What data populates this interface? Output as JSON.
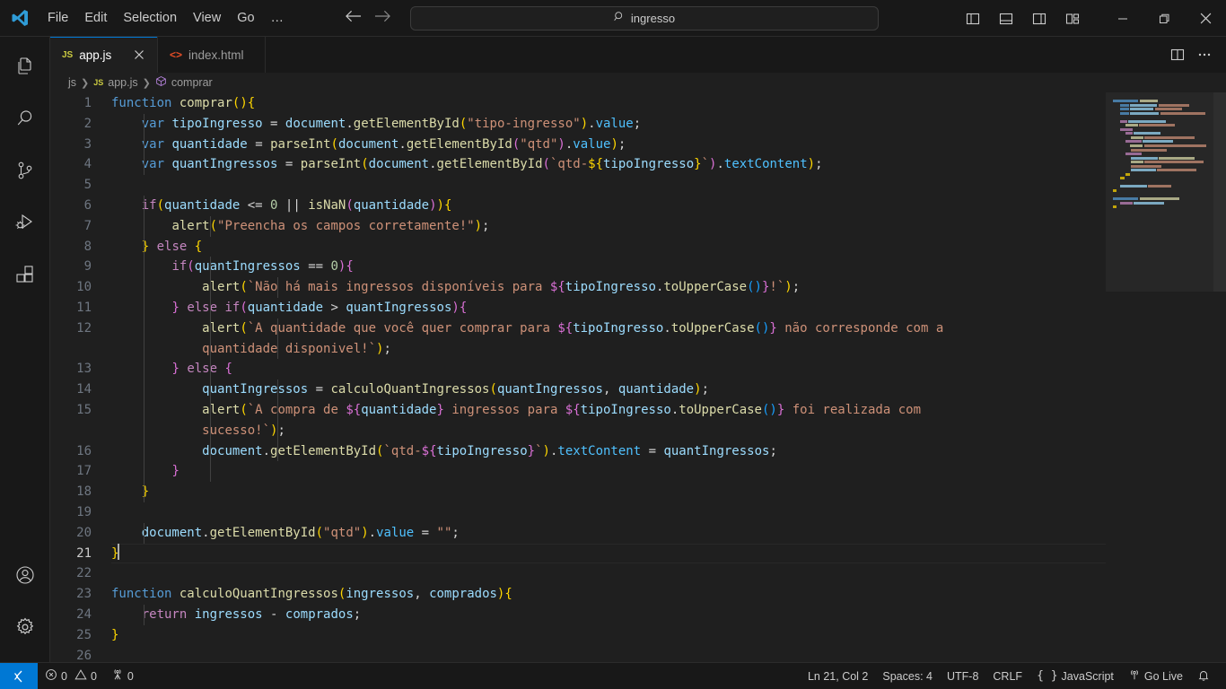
{
  "titlebar": {
    "logo_icon": "vscode-logo-icon",
    "menus": [
      "File",
      "Edit",
      "Selection",
      "View",
      "Go"
    ],
    "more_label": "…",
    "nav_back_icon": "arrow-left-icon",
    "nav_forward_icon": "arrow-right-icon",
    "command_center": {
      "search_icon": "search-icon",
      "value": "ingresso"
    },
    "layout_buttons": [
      {
        "name": "toggle-primary-sidebar-icon",
        "title": "Toggle Primary Side Bar"
      },
      {
        "name": "toggle-panel-icon",
        "title": "Toggle Panel"
      },
      {
        "name": "toggle-secondary-sidebar-icon",
        "title": "Toggle Secondary Side Bar"
      },
      {
        "name": "customize-layout-icon",
        "title": "Customize Layout"
      }
    ],
    "window_controls": [
      {
        "name": "minimize-button",
        "glyph": "—"
      },
      {
        "name": "maximize-button",
        "glyph": "❐"
      },
      {
        "name": "close-button",
        "glyph": "✕"
      }
    ]
  },
  "activitybar": {
    "top_items": [
      {
        "name": "sidebar-item-explorer",
        "label": "Explorer",
        "icon": "files-icon"
      },
      {
        "name": "sidebar-item-search",
        "label": "Search",
        "icon": "search-icon"
      },
      {
        "name": "sidebar-item-source-control",
        "label": "Source Control",
        "icon": "source-control-icon"
      },
      {
        "name": "sidebar-item-run-debug",
        "label": "Run and Debug",
        "icon": "run-debug-icon"
      },
      {
        "name": "sidebar-item-extensions",
        "label": "Extensions",
        "icon": "extensions-icon"
      }
    ],
    "bottom_items": [
      {
        "name": "accounts-button",
        "label": "Accounts",
        "icon": "account-icon"
      },
      {
        "name": "settings-button",
        "label": "Manage",
        "icon": "gear-icon"
      }
    ]
  },
  "tabs": [
    {
      "name": "tab-app-js",
      "label": "app.js",
      "icon": "js-file-icon",
      "icon_text": "JS",
      "active": true,
      "close_icon": "close-icon"
    },
    {
      "name": "tab-index-html",
      "label": "index.html",
      "icon": "html-file-icon",
      "icon_text": "<>",
      "active": false
    }
  ],
  "tabbar_actions": [
    {
      "name": "split-editor-right-button",
      "icon": "split-editor-icon"
    },
    {
      "name": "more-editor-actions-button",
      "icon": "ellipsis-icon"
    }
  ],
  "breadcrumb": {
    "segments": [
      {
        "name": "breadcrumb-folder-js",
        "label": "js",
        "icon": null
      },
      {
        "name": "breadcrumb-file-app-js",
        "label": "app.js",
        "icon": "js-file-icon"
      },
      {
        "name": "breadcrumb-symbol-comprar",
        "label": "comprar",
        "icon": "symbol-function-icon"
      }
    ],
    "separator": "❯"
  },
  "editor": {
    "language": "javascript",
    "cursor": {
      "line": 21,
      "column": 2
    },
    "lines": [
      {
        "num": 1,
        "text": "function comprar(){"
      },
      {
        "num": 2,
        "text": "    var tipoIngresso = document.getElementById(\"tipo-ingresso\").value;"
      },
      {
        "num": 3,
        "text": "    var quantidade = parseInt(document.getElementById(\"qtd\").value);"
      },
      {
        "num": 4,
        "text": "    var quantIngressos = parseInt(document.getElementById(`qtd-${tipoIngresso}`).textContent);"
      },
      {
        "num": 5,
        "text": ""
      },
      {
        "num": 6,
        "text": "    if(quantidade <= 0 || isNaN(quantidade)){"
      },
      {
        "num": 7,
        "text": "        alert(\"Preencha os campos corretamente!\");"
      },
      {
        "num": 8,
        "text": "    } else {"
      },
      {
        "num": 9,
        "text": "        if(quantIngressos == 0){"
      },
      {
        "num": 10,
        "text": "            alert(`Não há mais ingressos disponíveis para ${tipoIngresso.toUpperCase()}!`);"
      },
      {
        "num": 11,
        "text": "        } else if(quantidade > quantIngressos){"
      },
      {
        "num": 12,
        "text": "            alert(`A quantidade que você quer comprar para ${tipoIngresso.toUpperCase()} não corresponde com a quantidade disponivel!`);"
      },
      {
        "num": 13,
        "text": "        } else {"
      },
      {
        "num": 14,
        "text": "            quantIngressos = calculoQuantIngressos(quantIngressos, quantidade);"
      },
      {
        "num": 15,
        "text": "            alert(`A compra de ${quantidade} ingressos para ${tipoIngresso.toUpperCase()} foi realizada com sucesso!`);"
      },
      {
        "num": 16,
        "text": "            document.getElementById(`qtd-${tipoIngresso}`).textContent = quantIngressos;"
      },
      {
        "num": 17,
        "text": "        }"
      },
      {
        "num": 18,
        "text": "    }"
      },
      {
        "num": 19,
        "text": ""
      },
      {
        "num": 20,
        "text": "    document.getElementById(\"qtd\").value = \"\";"
      },
      {
        "num": 21,
        "text": "}"
      },
      {
        "num": 22,
        "text": ""
      },
      {
        "num": 23,
        "text": "function calculoQuantIngressos(ingressos, comprados){"
      },
      {
        "num": 24,
        "text": "    return ingressos - comprados;"
      },
      {
        "num": 25,
        "text": "}"
      },
      {
        "num": 26,
        "text": ""
      }
    ]
  },
  "statusbar": {
    "remote_icon": "remote-window-icon",
    "left_items": [
      {
        "name": "status-problems",
        "icon": "error-icon",
        "errors": "0",
        "warn_icon": "warning-icon",
        "warnings": "0"
      },
      {
        "name": "status-ports",
        "icon": "radio-tower-icon",
        "label": "0"
      }
    ],
    "right_items": [
      {
        "name": "status-cursor-position",
        "label": "Ln 21, Col 2"
      },
      {
        "name": "status-indentation",
        "label": "Spaces: 4"
      },
      {
        "name": "status-encoding",
        "label": "UTF-8"
      },
      {
        "name": "status-eol",
        "label": "CRLF"
      },
      {
        "name": "status-language-mode",
        "label": "JavaScript",
        "icon": "braces-icon"
      },
      {
        "name": "status-go-live",
        "label": "Go Live",
        "icon": "broadcast-icon"
      },
      {
        "name": "status-notifications",
        "label": "",
        "icon": "bell-icon"
      }
    ]
  },
  "colors": {
    "accent": "#0078d4",
    "titlebar_bg": "#181818",
    "editor_bg": "#1f1f1f",
    "statusbar_bg": "#181818",
    "keyword": "#c586c0",
    "declaration": "#569cd6",
    "function": "#dcdcaa",
    "variable": "#9cdcfe",
    "string": "#ce9178",
    "number": "#b5cea8",
    "property": "#4fc1ff"
  }
}
